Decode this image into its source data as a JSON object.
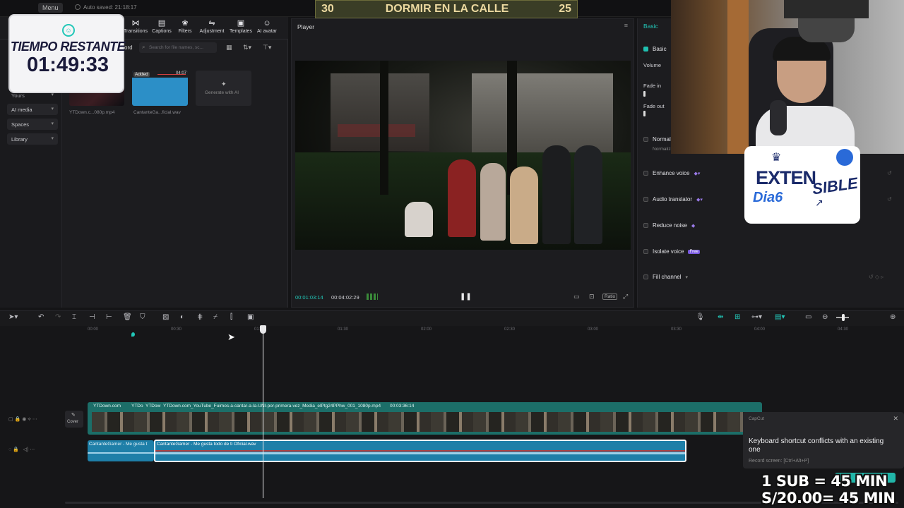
{
  "topbar": {
    "menu_label": "Menu",
    "autosave": "Auto saved: 21:18:17"
  },
  "toolstrip": {
    "items": [
      "Transitions",
      "Captions",
      "Filters",
      "Adjustment",
      "Templates",
      "AI avatar"
    ]
  },
  "sidebar": {
    "items": [
      "Yours",
      "AI media",
      "Spaces",
      "Library"
    ]
  },
  "media": {
    "record_label": "ord",
    "search_placeholder": "Search for file names, sc...",
    "items": [
      {
        "name": "YTDown.c...080p.mp4"
      },
      {
        "name": "CantanteGa...ficial.wav",
        "badge": "Added",
        "duration": "04:07"
      }
    ],
    "generate_label": "Generate with AI"
  },
  "player": {
    "title": "Player",
    "current_time": "00:01:03:14",
    "total_time": "00:04:02:29",
    "ratio_label": "Ratio"
  },
  "right_panel": {
    "tab_basic": "Basic",
    "tab_basic_small": "Basic",
    "volume_label": "Volume",
    "fade_in_label": "Fade in",
    "fade_out_label": "Fade out",
    "normalize_label": "Normal",
    "normalize_sub": "Normalize to",
    "enhance_voice": "Enhance voice",
    "audio_translator": "Audio translator",
    "reduce_noise": "Reduce noise",
    "isolate_voice": "Isolate voice",
    "isolate_badge": "Free",
    "fill_channel": "Fill channel"
  },
  "timeline": {
    "ticks": [
      "00:00",
      "00:30",
      "01:00",
      "01:30",
      "02:00",
      "02:30",
      "03:00",
      "03:30",
      "04:00",
      "04:30"
    ],
    "cover_label": "Cover",
    "video_clip_labels": [
      "YTDown.com",
      "YTDo",
      "YTDow"
    ],
    "video_clip_main": "YTDown.com_YouTube_Fuimos-a-cantar-a-la-UNI-por-primera-vez_Media_elPtg24PPhw_001_1080p.mp4",
    "video_clip_duration": "00:03:36:14",
    "audio_clip_a": "CantanteGamer - Me gusta t",
    "audio_clip_b": "CantanteGamer - Me gusta todo de ti Oficial.wav"
  },
  "toast": {
    "app": "CapCut",
    "message": "Keyboard shortcut conflicts with an existing one",
    "sub": "Record screen: [Ctrl+Alt+P]"
  },
  "overlay_timer": {
    "title": "TIEMPO RESTANTE",
    "time": "01:49:33"
  },
  "overlay_banner": {
    "left_num": "30",
    "text": "DORMIR EN LA CALLE",
    "right_num": "25"
  },
  "overlay_badge": {
    "line1": "EXTEN",
    "line1b": "SIBLE",
    "line2": "Dia6"
  },
  "overlay_sub": {
    "line1": "1 SUB = 45 MIN",
    "line2": "S/20.00= 45 MIN"
  },
  "colors": {
    "accent": "#20c0b0",
    "time_current": "#22c7b8",
    "clip_video": "#1c6e68",
    "clip_audio": "#1e7fa8"
  }
}
